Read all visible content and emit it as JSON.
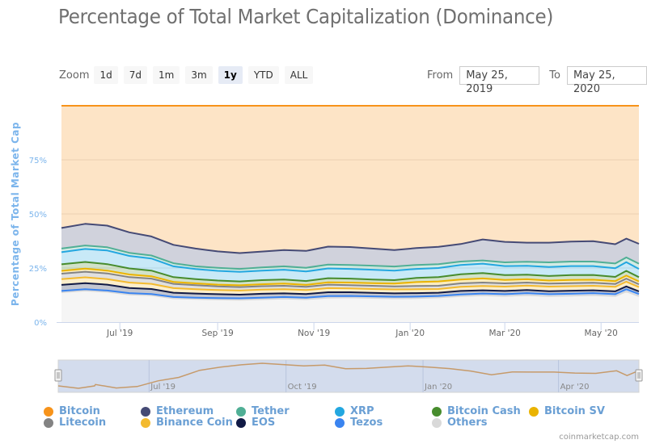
{
  "title": "Percentage of Total Market Capitalization (Dominance)",
  "zoom": {
    "label": "Zoom",
    "buttons": [
      "1d",
      "7d",
      "1m",
      "3m",
      "1y",
      "YTD",
      "ALL"
    ],
    "active": "1y"
  },
  "range": {
    "from_label": "From",
    "from_value": "May 25, 2019",
    "to_label": "To",
    "to_value": "May 25, 2020"
  },
  "credit": "coinmarketcap.com",
  "navigator": {
    "ticks": [
      "Jul '19",
      "Oct '19",
      "Jan '20",
      "Apr '20"
    ]
  },
  "chart_data": {
    "type": "area",
    "stacked": "percent",
    "title": "Percentage of Total Market Capitalization (Dominance)",
    "ylabel": "Percentage of Total Market Cap",
    "xlabel": "",
    "ylim": [
      0,
      100
    ],
    "yticks": [
      "0%",
      "25%",
      "50%",
      "75%"
    ],
    "xticks": [
      "Jul '19",
      "Sep '19",
      "Nov '19",
      "Jan '20",
      "Mar '20",
      "May '20"
    ],
    "x_range": [
      "2019-05-25",
      "2020-05-25"
    ],
    "x": [
      "2019-05-26",
      "2019-06-09",
      "2019-06-23",
      "2019-07-07",
      "2019-07-21",
      "2019-08-04",
      "2019-08-18",
      "2019-09-01",
      "2019-09-15",
      "2019-09-29",
      "2019-10-13",
      "2019-10-27",
      "2019-11-10",
      "2019-11-24",
      "2019-12-08",
      "2019-12-22",
      "2020-01-05",
      "2020-01-19",
      "2020-02-02",
      "2020-02-16",
      "2020-03-01",
      "2020-03-15",
      "2020-03-29",
      "2020-04-12",
      "2020-04-26",
      "2020-05-10",
      "2020-05-17",
      "2020-05-24"
    ],
    "legend_position": "bottom",
    "series": [
      {
        "name": "Others",
        "color": "#d9d9d9",
        "values": [
          13.8,
          14.6,
          14.0,
          12.8,
          12.4,
          11.0,
          10.7,
          10.5,
          10.3,
          10.6,
          10.9,
          10.6,
          11.3,
          11.4,
          11.2,
          11.0,
          11.1,
          11.4,
          12.0,
          12.4,
          12.1,
          12.5,
          12.0,
          12.2,
          12.5,
          12.0,
          14.2,
          12.0
        ]
      },
      {
        "name": "Tezos",
        "color": "#3a84f0",
        "values": [
          0.6,
          0.6,
          0.6,
          0.6,
          0.6,
          0.6,
          0.6,
          0.6,
          0.7,
          0.7,
          0.7,
          0.7,
          0.7,
          0.7,
          0.7,
          0.7,
          0.7,
          0.7,
          0.8,
          0.8,
          0.8,
          0.9,
          0.9,
          0.9,
          0.9,
          0.9,
          1.0,
          1.0
        ]
      },
      {
        "name": "EOS",
        "color": "#111a45",
        "values": [
          2.8,
          2.8,
          2.7,
          2.4,
          2.3,
          2.0,
          1.9,
          1.8,
          1.7,
          1.8,
          1.7,
          1.7,
          1.8,
          1.7,
          1.6,
          1.6,
          1.6,
          1.5,
          1.6,
          1.5,
          1.5,
          1.4,
          1.4,
          1.4,
          1.3,
          1.3,
          1.3,
          1.2
        ]
      },
      {
        "name": "Binance Coin",
        "color": "#f3ba2f",
        "values": [
          2.7,
          2.7,
          2.6,
          2.5,
          2.4,
          2.1,
          2.0,
          1.9,
          1.9,
          1.9,
          1.9,
          1.8,
          1.9,
          1.8,
          1.8,
          1.8,
          1.8,
          1.7,
          1.9,
          2.0,
          2.0,
          2.1,
          2.1,
          2.1,
          2.1,
          2.1,
          2.2,
          2.0
        ]
      },
      {
        "name": "Litecoin",
        "color": "#838383",
        "values": [
          2.5,
          2.6,
          2.6,
          2.5,
          2.4,
          2.0,
          1.9,
          1.7,
          1.6,
          1.6,
          1.6,
          1.5,
          1.6,
          1.5,
          1.5,
          1.4,
          1.5,
          1.5,
          1.6,
          1.6,
          1.5,
          1.4,
          1.4,
          1.4,
          1.4,
          1.3,
          1.4,
          1.3
        ]
      },
      {
        "name": "Bitcoin SV",
        "color": "#eab300",
        "values": [
          1.3,
          1.4,
          1.3,
          1.2,
          1.1,
          0.9,
          0.8,
          0.8,
          0.8,
          0.9,
          1.0,
          0.9,
          1.1,
          1.2,
          1.2,
          1.3,
          1.8,
          2.0,
          1.8,
          1.9,
          1.6,
          1.5,
          1.4,
          1.5,
          1.4,
          1.3,
          1.4,
          1.3
        ]
      },
      {
        "name": "Bitcoin Cash",
        "color": "#478c2d",
        "values": [
          3.0,
          3.1,
          3.0,
          2.8,
          2.6,
          2.2,
          2.0,
          1.9,
          1.8,
          1.9,
          1.9,
          1.8,
          1.9,
          1.8,
          1.7,
          1.6,
          1.9,
          2.0,
          2.4,
          2.5,
          2.2,
          2.1,
          2.1,
          2.2,
          2.2,
          2.0,
          2.2,
          2.0
        ]
      },
      {
        "name": "XRP",
        "color": "#23a7e0",
        "values": [
          5.6,
          6.0,
          6.3,
          5.8,
          5.6,
          5.0,
          4.6,
          4.5,
          4.4,
          4.4,
          4.5,
          4.4,
          4.5,
          4.5,
          4.5,
          4.4,
          4.2,
          4.2,
          4.3,
          4.3,
          4.2,
          4.1,
          4.2,
          4.2,
          4.1,
          4.0,
          4.0,
          3.8
        ]
      },
      {
        "name": "Tether",
        "color": "#50af95",
        "values": [
          1.7,
          1.6,
          1.5,
          1.4,
          1.4,
          1.4,
          1.3,
          1.4,
          1.4,
          1.5,
          1.6,
          1.7,
          1.8,
          1.8,
          1.9,
          1.9,
          1.8,
          1.8,
          1.6,
          1.5,
          1.7,
          1.9,
          2.1,
          2.1,
          2.1,
          2.2,
          2.2,
          2.4
        ]
      },
      {
        "name": "Ethereum",
        "color": "#454a75",
        "values": [
          9.5,
          10.0,
          10.0,
          9.5,
          8.8,
          8.5,
          8.2,
          7.6,
          7.3,
          7.3,
          7.5,
          7.8,
          8.3,
          8.3,
          7.9,
          7.6,
          7.8,
          8.0,
          8.1,
          9.7,
          9.5,
          8.8,
          9.1,
          9.2,
          9.4,
          8.9,
          8.7,
          9.2
        ]
      },
      {
        "name": "Bitcoin",
        "color": "#f7931a",
        "values": [
          56.5,
          54.6,
          55.4,
          58.5,
          60.4,
          64.3,
          66.0,
          67.3,
          68.1,
          67.4,
          66.7,
          67.1,
          65.1,
          65.3,
          66.0,
          66.7,
          66.0,
          65.2,
          63.9,
          61.8,
          63.4,
          63.3,
          63.3,
          62.8,
          62.6,
          64.0,
          61.4,
          63.8
        ]
      }
    ],
    "legend": [
      {
        "name": "Bitcoin",
        "color": "#f7931a"
      },
      {
        "name": "Ethereum",
        "color": "#454a75"
      },
      {
        "name": "Tether",
        "color": "#50af95"
      },
      {
        "name": "XRP",
        "color": "#23a7e0"
      },
      {
        "name": "Bitcoin Cash",
        "color": "#478c2d"
      },
      {
        "name": "Bitcoin SV",
        "color": "#eab300"
      },
      {
        "name": "Litecoin",
        "color": "#838383"
      },
      {
        "name": "Binance Coin",
        "color": "#f3ba2f"
      },
      {
        "name": "EOS",
        "color": "#111a45"
      },
      {
        "name": "Tezos",
        "color": "#3a84f0"
      },
      {
        "name": "Others",
        "color": "#d9d9d9"
      }
    ]
  }
}
